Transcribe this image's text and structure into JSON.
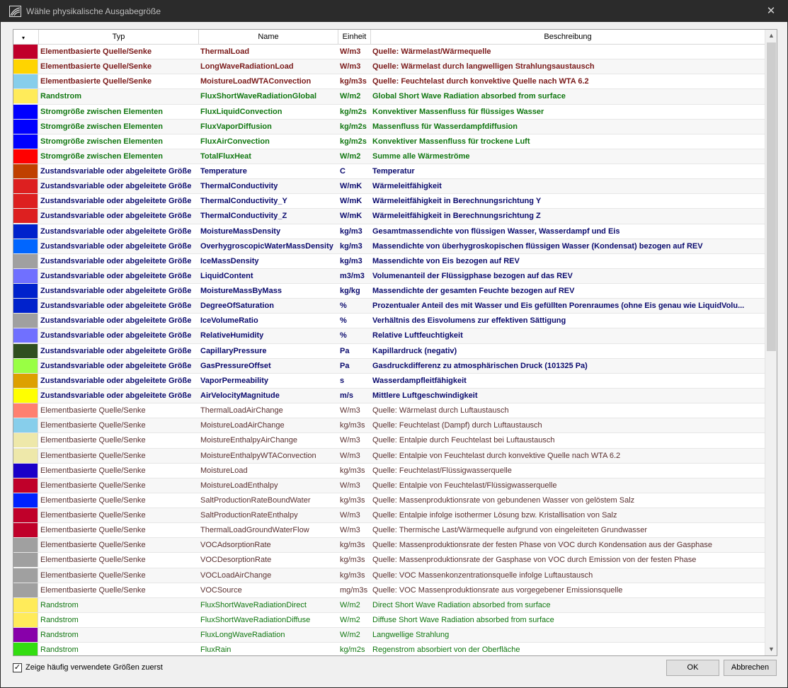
{
  "window": {
    "title": "Wähle physikalische Ausgabegröße",
    "close_glyph": "✕"
  },
  "table": {
    "sort_indicator": "▾",
    "headers": {
      "type": "Typ",
      "name": "Name",
      "unit": "Einheit",
      "description": "Beschreibung"
    },
    "rows": [
      {
        "color": "#c0002a",
        "type": "Elementbasierte Quelle/Senke",
        "name": "ThermalLoad",
        "unit": "W/m3",
        "description": "Quelle: Wärmelast/Wärmequelle",
        "text_color": "#7a1a1a",
        "bold": true
      },
      {
        "color": "#ffd400",
        "type": "Elementbasierte Quelle/Senke",
        "name": "LongWaveRadiationLoad",
        "unit": "W/m3",
        "description": "Quelle: Wärmelast durch langwelligen Strahlungsaustausch",
        "text_color": "#7a1a1a",
        "bold": true
      },
      {
        "color": "#87ceeb",
        "type": "Elementbasierte Quelle/Senke",
        "name": "MoistureLoadWTAConvection",
        "unit": "kg/m3s",
        "description": "Quelle: Feuchtelast durch konvektive Quelle nach WTA 6.2",
        "text_color": "#7a1a1a",
        "bold": true
      },
      {
        "color": "#ffeb5a",
        "type": "Randstrom",
        "name": "FluxShortWaveRadiationGlobal",
        "unit": "W/m2",
        "description": "Global Short Wave Radiation absorbed from surface",
        "text_color": "#117711",
        "bold": true
      },
      {
        "color": "#0000ff",
        "type": "Stromgröße zwischen Elementen",
        "name": "FluxLiquidConvection",
        "unit": "kg/m2s",
        "description": "Konvektiver Massenfluss für flüssiges Wasser",
        "text_color": "#117711",
        "bold": true
      },
      {
        "color": "#0000ff",
        "type": "Stromgröße zwischen Elementen",
        "name": "FluxVaporDiffusion",
        "unit": "kg/m2s",
        "description": "Massenfluss für Wasserdampfdiffusion",
        "text_color": "#117711",
        "bold": true
      },
      {
        "color": "#0000ff",
        "type": "Stromgröße zwischen Elementen",
        "name": "FluxAirConvection",
        "unit": "kg/m2s",
        "description": "Konvektiver Massenfluss für trockene Luft",
        "text_color": "#117711",
        "bold": true
      },
      {
        "color": "#ff0000",
        "type": "Stromgröße zwischen Elementen",
        "name": "TotalFluxHeat",
        "unit": "W/m2",
        "description": "Summe alle Wärmeströme",
        "text_color": "#117711",
        "bold": true
      },
      {
        "color": "#c04000",
        "type": "Zustandsvariable oder abgeleitete Größe",
        "name": "Temperature",
        "unit": "C",
        "description": "Temperatur",
        "text_color": "#0a0a6e",
        "bold": true
      },
      {
        "color": "#dd2020",
        "type": "Zustandsvariable oder abgeleitete Größe",
        "name": "ThermalConductivity",
        "unit": "W/mK",
        "description": "Wärmeleitfähigkeit",
        "text_color": "#0a0a6e",
        "bold": true
      },
      {
        "color": "#dd2020",
        "type": "Zustandsvariable oder abgeleitete Größe",
        "name": "ThermalConductivity_Y",
        "unit": "W/mK",
        "description": "Wärmeleitfähigkeit in Berechnungsrichtung Y",
        "text_color": "#0a0a6e",
        "bold": true
      },
      {
        "color": "#dd2020",
        "type": "Zustandsvariable oder abgeleitete Größe",
        "name": "ThermalConductivity_Z",
        "unit": "W/mK",
        "description": "Wärmeleitfähigkeit in Berechnungsrichtung Z",
        "text_color": "#0a0a6e",
        "bold": true
      },
      {
        "color": "#0022cc",
        "type": "Zustandsvariable oder abgeleitete Größe",
        "name": "MoistureMassDensity",
        "unit": "kg/m3",
        "description": "Gesamtmassendichte von flüssigen Wasser, Wasserdampf und Eis",
        "text_color": "#0a0a6e",
        "bold": true
      },
      {
        "color": "#0066ff",
        "type": "Zustandsvariable oder abgeleitete Größe",
        "name": "OverhygroscopicWaterMassDensity",
        "unit": "kg/m3",
        "description": "Massendichte von überhygroskopischen flüssigen Wasser (Kondensat) bezogen auf REV",
        "text_color": "#0a0a6e",
        "bold": true
      },
      {
        "color": "#a0a0a0",
        "type": "Zustandsvariable oder abgeleitete Größe",
        "name": "IceMassDensity",
        "unit": "kg/m3",
        "description": "Massendichte von Eis bezogen auf REV",
        "text_color": "#0a0a6e",
        "bold": true
      },
      {
        "color": "#7070ff",
        "type": "Zustandsvariable oder abgeleitete Größe",
        "name": "LiquidContent",
        "unit": "m3/m3",
        "description": "Volumenanteil der Flüssigphase bezogen auf das REV",
        "text_color": "#0a0a6e",
        "bold": true
      },
      {
        "color": "#0022cc",
        "type": "Zustandsvariable oder abgeleitete Größe",
        "name": "MoistureMassByMass",
        "unit": "kg/kg",
        "description": "Massendichte der gesamten Feuchte bezogen auf REV",
        "text_color": "#0a0a6e",
        "bold": true
      },
      {
        "color": "#0022cc",
        "type": "Zustandsvariable oder abgeleitete Größe",
        "name": "DegreeOfSaturation",
        "unit": "%",
        "description": "Prozentualer Anteil des mit Wasser und Eis gefüllten Porenraumes (ohne Eis genau wie LiquidVolu...",
        "text_color": "#0a0a6e",
        "bold": true
      },
      {
        "color": "#a0a0a0",
        "type": "Zustandsvariable oder abgeleitete Größe",
        "name": "IceVolumeRatio",
        "unit": "%",
        "description": "Verhältnis des Eisvolumens zur effektiven Sättigung",
        "text_color": "#0a0a6e",
        "bold": true
      },
      {
        "color": "#7070ff",
        "type": "Zustandsvariable oder abgeleitete Größe",
        "name": "RelativeHumidity",
        "unit": "%",
        "description": "Relative Luftfeuchtigkeit",
        "text_color": "#0a0a6e",
        "bold": true
      },
      {
        "color": "#2f4f1f",
        "type": "Zustandsvariable oder abgeleitete Größe",
        "name": "CapillaryPressure",
        "unit": "Pa",
        "description": "Kapillardruck (negativ)",
        "text_color": "#0a0a6e",
        "bold": true
      },
      {
        "color": "#99ff44",
        "type": "Zustandsvariable oder abgeleitete Größe",
        "name": "GasPressureOffset",
        "unit": "Pa",
        "description": "Gasdruckdifferenz zu atmosphärischen Druck (101325 Pa)",
        "text_color": "#0a0a6e",
        "bold": true
      },
      {
        "color": "#dda000",
        "type": "Zustandsvariable oder abgeleitete Größe",
        "name": "VaporPermeability",
        "unit": "s",
        "description": "Wasserdampfleitfähigkeit",
        "text_color": "#0a0a6e",
        "bold": true
      },
      {
        "color": "#ffff00",
        "type": "Zustandsvariable oder abgeleitete Größe",
        "name": "AirVelocityMagnitude",
        "unit": "m/s",
        "description": "Mittlere Luftgeschwindigkeit",
        "text_color": "#0a0a6e",
        "bold": true
      },
      {
        "color": "#ff8070",
        "type": "Elementbasierte Quelle/Senke",
        "name": "ThermalLoadAirChange",
        "unit": "W/m3",
        "description": "Quelle: Wärmelast durch Luftaustausch",
        "text_color": "#5a3030",
        "bold": false
      },
      {
        "color": "#87ceeb",
        "type": "Elementbasierte Quelle/Senke",
        "name": "MoistureLoadAirChange",
        "unit": "kg/m3s",
        "description": "Quelle: Feuchtelast (Dampf) durch Luftaustausch",
        "text_color": "#5a3030",
        "bold": false
      },
      {
        "color": "#eee8aa",
        "type": "Elementbasierte Quelle/Senke",
        "name": "MoistureEnthalpyAirChange",
        "unit": "W/m3",
        "description": "Quelle: Entalpie durch Feuchtelast bei Luftaustausch",
        "text_color": "#5a3030",
        "bold": false
      },
      {
        "color": "#eee8aa",
        "type": "Elementbasierte Quelle/Senke",
        "name": "MoistureEnthalpyWTAConvection",
        "unit": "W/m3",
        "description": "Quelle: Entalpie von Feuchtelast durch konvektive Quelle nach WTA 6.2",
        "text_color": "#5a3030",
        "bold": false
      },
      {
        "color": "#1a00c8",
        "type": "Elementbasierte Quelle/Senke",
        "name": "MoistureLoad",
        "unit": "kg/m3s",
        "description": "Quelle: Feuchtelast/Flüssigwasserquelle",
        "text_color": "#5a3030",
        "bold": false
      },
      {
        "color": "#c0002a",
        "type": "Elementbasierte Quelle/Senke",
        "name": "MoistureLoadEnthalpy",
        "unit": "W/m3",
        "description": "Quelle: Entalpie von Feuchtelast/Flüssigwasserquelle",
        "text_color": "#5a3030",
        "bold": false
      },
      {
        "color": "#0022ff",
        "type": "Elementbasierte Quelle/Senke",
        "name": "SaltProductionRateBoundWater",
        "unit": "kg/m3s",
        "description": "Quelle: Massenproduktionsrate von gebundenen Wasser von gelöstem Salz",
        "text_color": "#5a3030",
        "bold": false
      },
      {
        "color": "#c0002a",
        "type": "Elementbasierte Quelle/Senke",
        "name": "SaltProductionRateEnthalpy",
        "unit": "W/m3",
        "description": "Quelle: Entalpie infolge isothermer Lösung bzw. Kristallisation von Salz",
        "text_color": "#5a3030",
        "bold": false
      },
      {
        "color": "#c0002a",
        "type": "Elementbasierte Quelle/Senke",
        "name": "ThermalLoadGroundWaterFlow",
        "unit": "W/m3",
        "description": "Quelle: Thermische Last/Wärmequelle aufgrund von eingeleiteten Grundwasser",
        "text_color": "#5a3030",
        "bold": false
      },
      {
        "color": "#a0a0a0",
        "type": "Elementbasierte Quelle/Senke",
        "name": "VOCAdsorptionRate",
        "unit": "kg/m3s",
        "description": "Quelle: Massenproduktionsrate der festen Phase von VOC durch Kondensation aus der Gasphase",
        "text_color": "#5a3030",
        "bold": false
      },
      {
        "color": "#a0a0a0",
        "type": "Elementbasierte Quelle/Senke",
        "name": "VOCDesorptionRate",
        "unit": "kg/m3s",
        "description": "Quelle: Massenproduktionsrate der Gasphase von VOC durch Emission von der festen Phase",
        "text_color": "#5a3030",
        "bold": false
      },
      {
        "color": "#a0a0a0",
        "type": "Elementbasierte Quelle/Senke",
        "name": "VOCLoadAirChange",
        "unit": "kg/m3s",
        "description": "Quelle: VOC Massenkonzentrationsquelle infolge Luftaustausch",
        "text_color": "#5a3030",
        "bold": false
      },
      {
        "color": "#a0a0a0",
        "type": "Elementbasierte Quelle/Senke",
        "name": "VOCSource",
        "unit": "mg/m3s",
        "description": "Quelle: VOC Massenproduktionsrate aus vorgegebener Emissionsquelle",
        "text_color": "#5a3030",
        "bold": false
      },
      {
        "color": "#ffeb5a",
        "type": "Randstrom",
        "name": "FluxShortWaveRadiationDirect",
        "unit": "W/m2",
        "description": "Direct Short Wave Radiation absorbed from surface",
        "text_color": "#117711",
        "bold": false
      },
      {
        "color": "#ffeb5a",
        "type": "Randstrom",
        "name": "FluxShortWaveRadiationDiffuse",
        "unit": "W/m2",
        "description": "Diffuse Short Wave Radiation absorbed from surface",
        "text_color": "#117711",
        "bold": false
      },
      {
        "color": "#8800aa",
        "type": "Randstrom",
        "name": "FluxLongWaveRadiation",
        "unit": "W/m2",
        "description": "Langwellige Strahlung",
        "text_color": "#117711",
        "bold": false
      },
      {
        "color": "#33dd11",
        "type": "Randstrom",
        "name": "FluxRain",
        "unit": "kg/m2s",
        "description": "Regenstrom absorbiert von der Oberfläche",
        "text_color": "#117711",
        "bold": false
      }
    ]
  },
  "scrollbar": {
    "up_glyph": "▲",
    "down_glyph": "▼"
  },
  "footer": {
    "checkbox_label": "Zeige häufig verwendete Größen zuerst",
    "checkbox_checked": true,
    "check_glyph": "✓",
    "ok_label": "OK",
    "cancel_label": "Abbrechen"
  }
}
